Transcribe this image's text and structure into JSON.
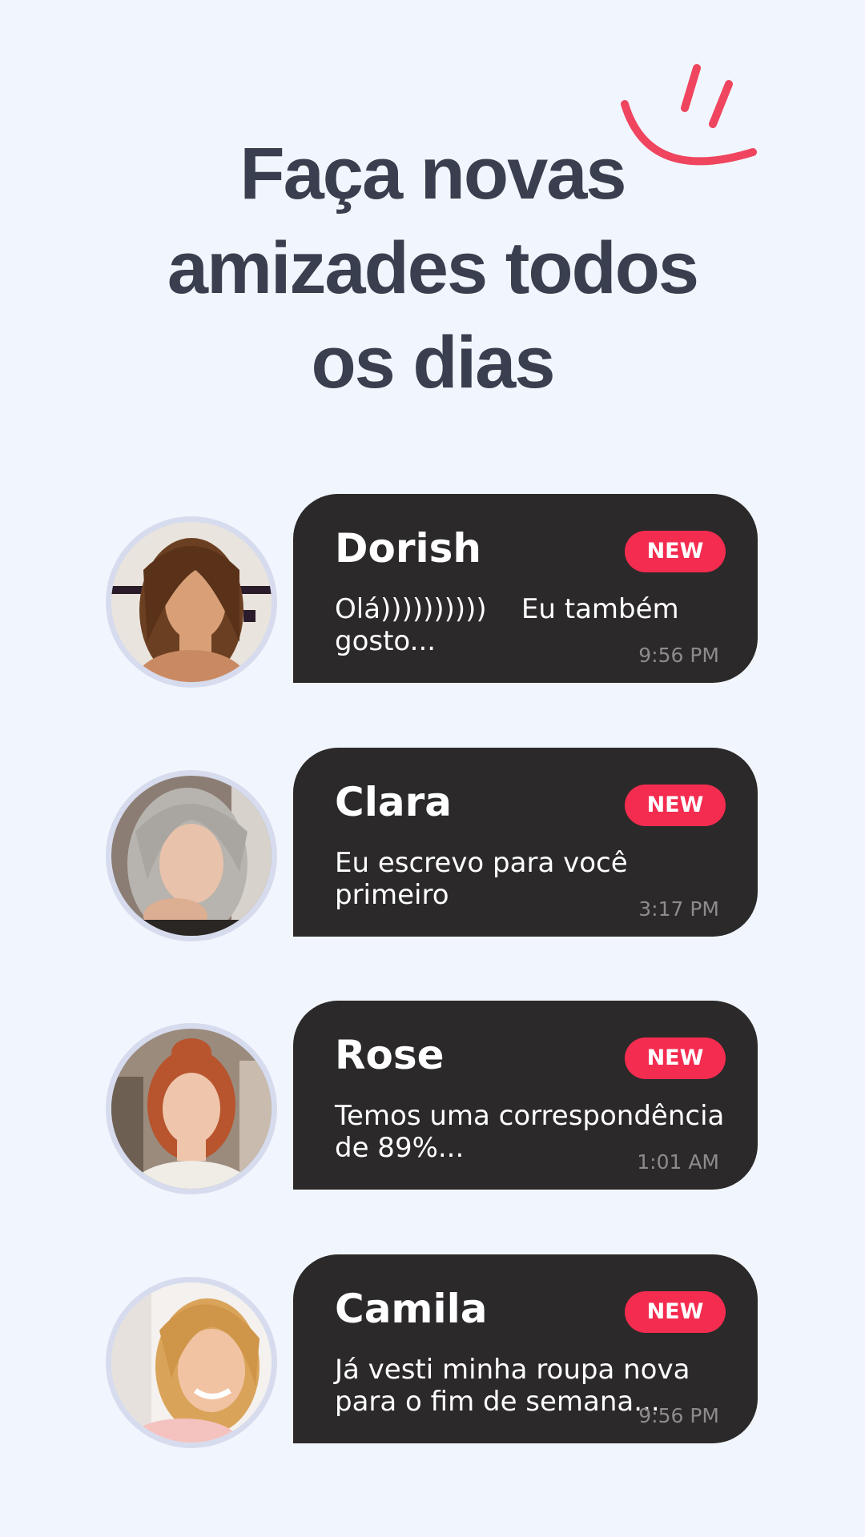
{
  "header": {
    "title_lines": [
      "Faça novas",
      "amizades todos",
      "os dias"
    ]
  },
  "colors": {
    "background": "#f1f6fe",
    "title": "#3a3f4f",
    "bubble": "#2b2929",
    "badge": "#f42c50",
    "smile": "#f0455e"
  },
  "chats": [
    {
      "name": "Dorish",
      "badge": "NEW",
      "message": "Olá))))))))))    Eu também gosto...",
      "time": "9:56 PM",
      "avatar_icon": "profile-photo"
    },
    {
      "name": "Clara",
      "badge": "NEW",
      "message": "Eu escrevo para você primeiro",
      "time": "3:17 PM",
      "avatar_icon": "profile-photo"
    },
    {
      "name": "Rose",
      "badge": "NEW",
      "message": "Temos uma correspondência de 89%...",
      "time": "1:01 AM",
      "avatar_icon": "profile-photo"
    },
    {
      "name": "Camila",
      "badge": "NEW",
      "message": "Já vesti minha roupa nova para o fim de semana...",
      "time": "9:56 PM",
      "avatar_icon": "profile-photo"
    }
  ]
}
